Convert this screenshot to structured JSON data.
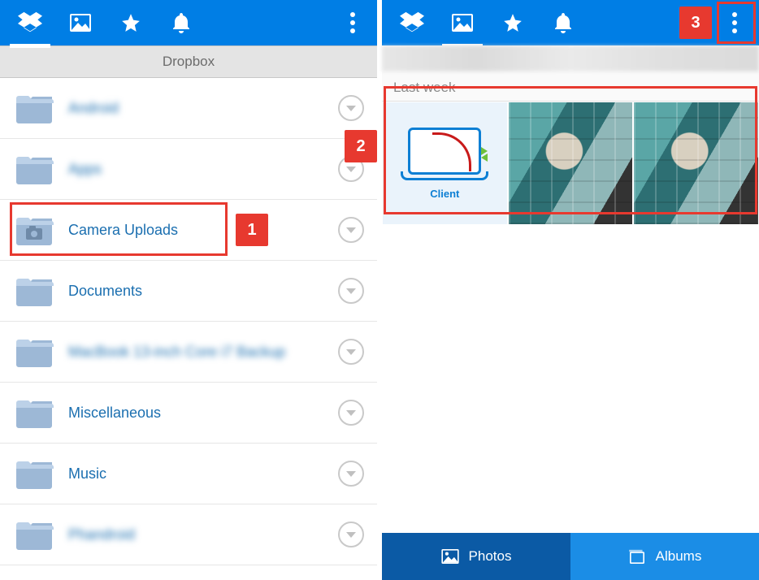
{
  "left": {
    "title": "Dropbox",
    "folders": [
      {
        "name": "Android",
        "blurred": true,
        "camera": false
      },
      {
        "name": "Apps",
        "blurred": true,
        "camera": false
      },
      {
        "name": "Camera Uploads",
        "blurred": false,
        "camera": true
      },
      {
        "name": "Documents",
        "blurred": false,
        "camera": false
      },
      {
        "name": "MacBook 13-inch Core i7 Backup",
        "blurred": true,
        "camera": false
      },
      {
        "name": "Miscellaneous",
        "blurred": false,
        "camera": false
      },
      {
        "name": "Music",
        "blurred": false,
        "camera": false
      },
      {
        "name": "Phandroid",
        "blurred": true,
        "camera": false
      }
    ]
  },
  "right": {
    "section_label": "Last week",
    "client_thumb_label": "Client",
    "bottom_tabs": {
      "photos": "Photos",
      "albums": "Albums"
    }
  },
  "annotations": {
    "one": "1",
    "two": "2",
    "three": "3"
  }
}
